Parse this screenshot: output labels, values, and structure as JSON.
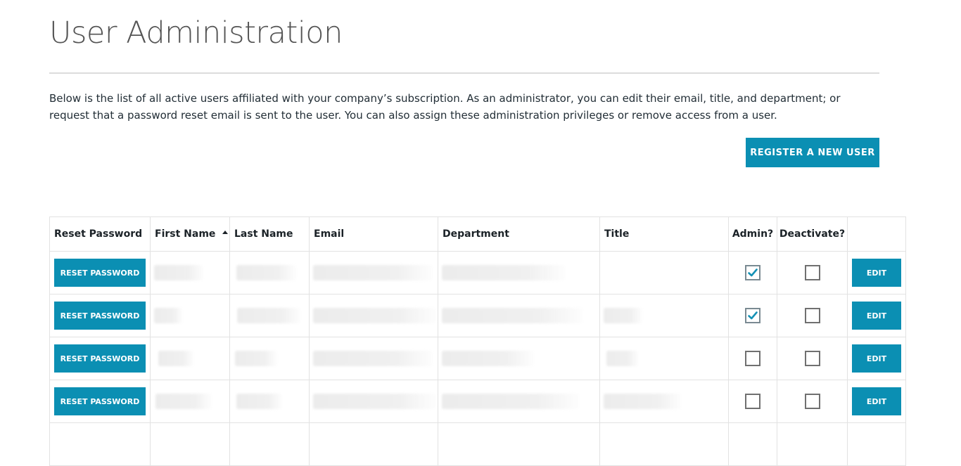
{
  "page": {
    "title": "User Administration",
    "intro": "Below is the list of all active users affiliated with your company’s subscription. As an administrator, you can edit their email, title, and department; or request that a password reset email is sent to the user. You can also assign these administration privileges or remove access from a user.",
    "register_label": "REGISTER A NEW USER"
  },
  "colors": {
    "accent": "#0b8fb3",
    "check": "#1591b5"
  },
  "table": {
    "headers": {
      "reset": "Reset Password",
      "first": "First Name",
      "last": "Last Name",
      "email": "Email",
      "department": "Department",
      "title": "Title",
      "admin": "Admin?",
      "deactivate": "Deactivate?",
      "edit": ""
    },
    "sort_icon": "sort-ascending-icon",
    "reset_label": "RESET PASSWORD",
    "edit_label": "EDIT",
    "rows": [
      {
        "admin": true,
        "deactivate": false
      },
      {
        "admin": true,
        "deactivate": false
      },
      {
        "admin": false,
        "deactivate": false
      },
      {
        "admin": false,
        "deactivate": false
      }
    ]
  }
}
